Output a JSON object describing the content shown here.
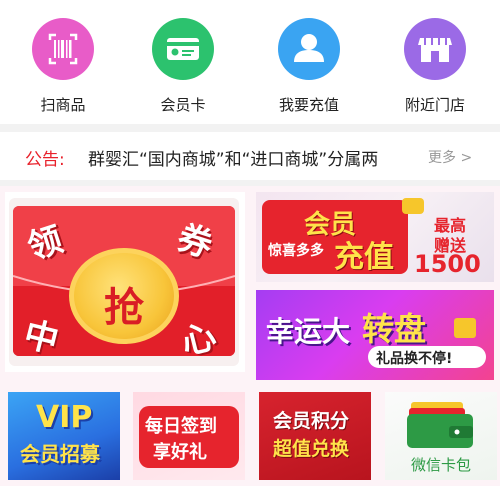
{
  "menu": {
    "items": [
      {
        "label": "扫商品",
        "icon": "barcode-scan-icon",
        "color": "#e85cc8"
      },
      {
        "label": "会员卡",
        "icon": "member-card-icon",
        "color": "#2cc26e"
      },
      {
        "label": "我要充值",
        "icon": "user-recharge-icon",
        "color": "#3aa4f2"
      },
      {
        "label": "附近门店",
        "icon": "store-icon",
        "color": "#9b6ae6"
      }
    ]
  },
  "notice": {
    "prefix": "公告:",
    "text": "群婴汇“国内商城”和“进口商城”分属两",
    "more": "更多 >"
  },
  "promo": {
    "coupon": {
      "tl": "领",
      "tr": "券",
      "center": "抢",
      "bl": "中",
      "br": "心"
    },
    "recharge": {
      "title": "会员",
      "subtitle": "惊喜多多",
      "title2": "充值",
      "max_label": "最高",
      "gift_label": "赠送",
      "amount": "1500"
    },
    "spin": {
      "title1": "幸运大",
      "title2": "转盘",
      "subtitle": "礼品换不停!"
    },
    "vip": {
      "line1": "VIP",
      "line2": "会员招募"
    },
    "sign": {
      "line1": "每日签到",
      "line2": "享好礼"
    },
    "points": {
      "line1": "会员积分",
      "line2": "超值兑换"
    },
    "wallet": {
      "label": "微信卡包"
    }
  }
}
